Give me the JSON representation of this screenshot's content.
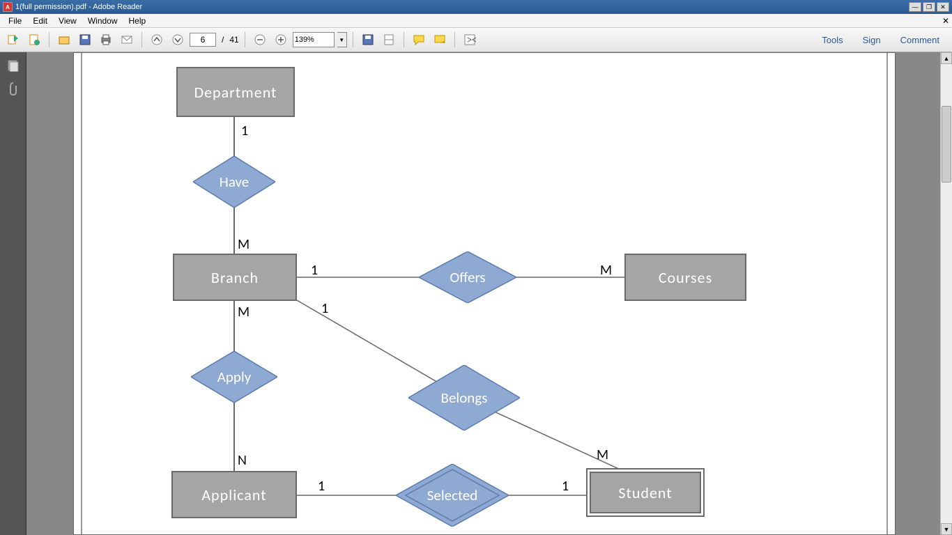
{
  "window": {
    "title": "1(full permission).pdf - Adobe Reader"
  },
  "menu": {
    "items": [
      "File",
      "Edit",
      "View",
      "Window",
      "Help"
    ]
  },
  "toolbar": {
    "page_current": "6",
    "page_total": "41",
    "zoom": "139%",
    "right": [
      "Tools",
      "Sign",
      "Comment"
    ]
  },
  "diagram": {
    "entities": {
      "department": "Department",
      "branch": "Branch",
      "courses": "Courses",
      "applicant": "Applicant",
      "student": "Student"
    },
    "relationships": {
      "have": "Have",
      "offers": "Offers",
      "apply": "Apply",
      "belongs": "Belongs",
      "selected": "Selected"
    },
    "card": {
      "dept_have": "1",
      "have_branch": "M",
      "branch_offers": "1",
      "offers_courses": "M",
      "branch_apply": "M",
      "apply_applicant": "N",
      "branch_belongs": "1",
      "belongs_student": "M",
      "applicant_selected": "1",
      "selected_student": "1"
    }
  }
}
